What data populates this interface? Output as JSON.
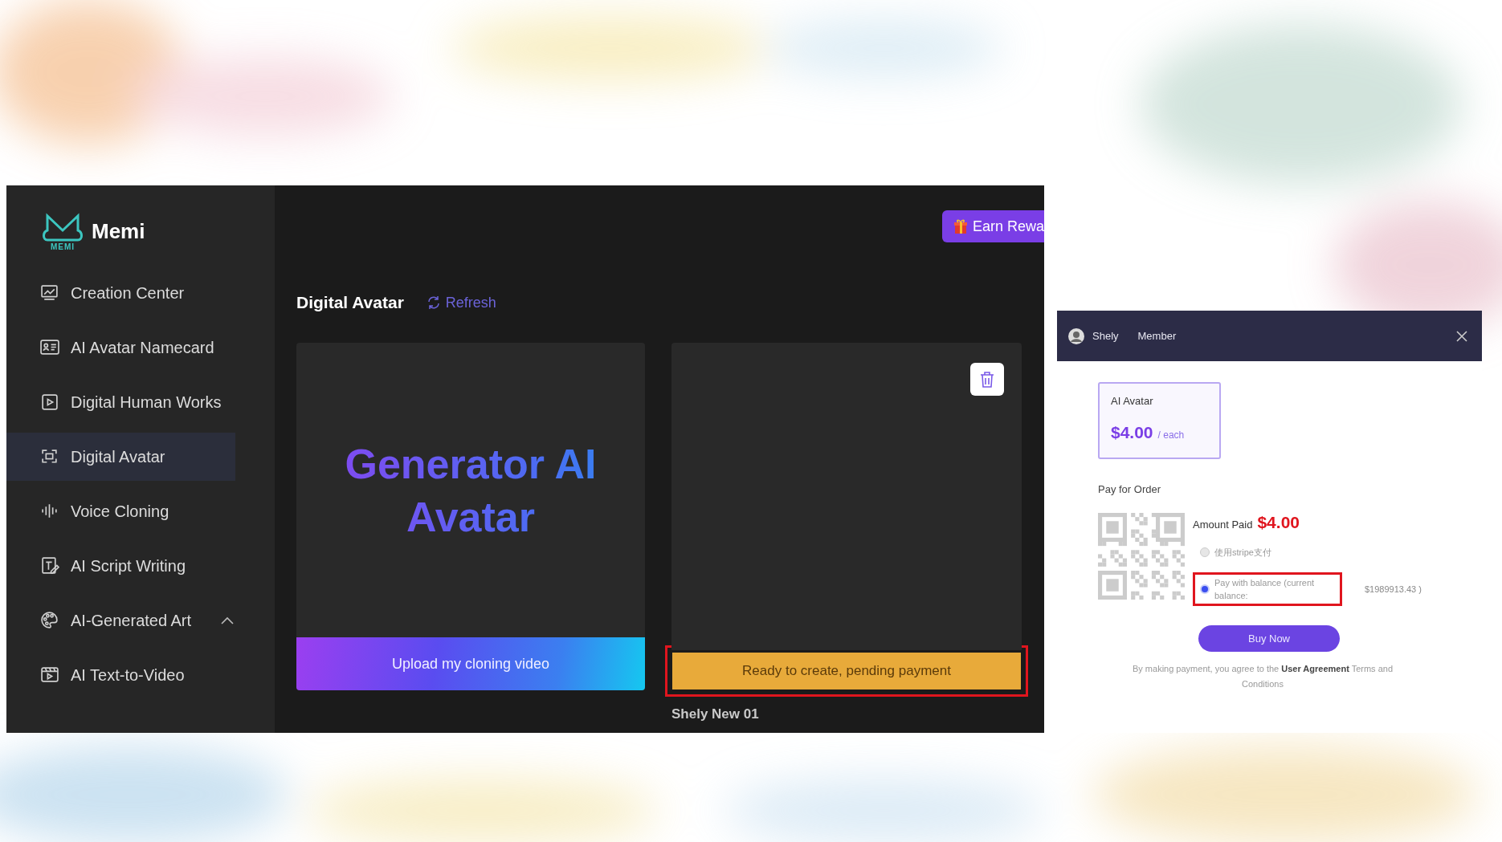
{
  "app": {
    "logo": {
      "mark": "MEMI",
      "name": "Memi"
    },
    "sidebar": {
      "items": [
        {
          "label": "Creation Center",
          "selected": false
        },
        {
          "label": "AI Avatar Namecard",
          "selected": false
        },
        {
          "label": "Digital Human Works",
          "selected": false
        },
        {
          "label": "Digital Avatar",
          "selected": true
        },
        {
          "label": "Voice Cloning",
          "selected": false
        },
        {
          "label": "AI Script Writing",
          "selected": false
        },
        {
          "label": "AI-Generated Art",
          "selected": false,
          "expanded": true
        },
        {
          "label": "AI Text-to-Video",
          "selected": false
        }
      ]
    },
    "earn_button": "Earn Rewa",
    "page_title": "Digital Avatar",
    "refresh": "Refresh",
    "cards": [
      {
        "kind": "generator",
        "heading": "Generator AI Avatar",
        "button": "Upload my cloning video"
      },
      {
        "kind": "work",
        "status": "Ready to create, pending payment",
        "highlighted": true,
        "caption": "Shely New 01"
      }
    ]
  },
  "dialog": {
    "user": "Shely",
    "role": "Member",
    "product": {
      "name": "AI Avatar",
      "price": "$4.00",
      "unit": "/ each"
    },
    "section_title": "Pay for Order",
    "amount_label": "Amount Paid",
    "amount": "$4.00",
    "payment_options": [
      {
        "label": "使用stripe支付",
        "selected": false
      },
      {
        "label": "Pay with balance (current balance:",
        "selected": true,
        "highlighted": true,
        "balance": "$1989913.43 )"
      }
    ],
    "buy_button": "Buy Now",
    "terms": "By making payment, you agree to the **User Agreement** Terms and Conditions"
  }
}
